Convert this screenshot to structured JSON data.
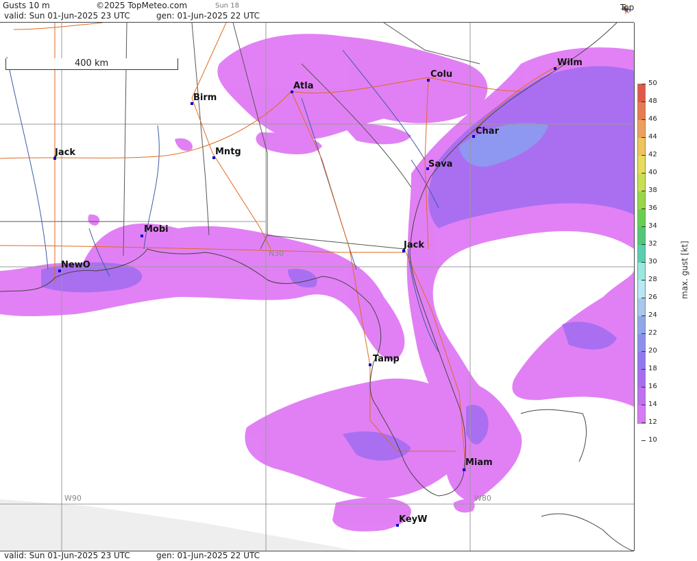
{
  "header": {
    "product": "Gusts 10 m",
    "copyright": "©2025 TopMeteo.com",
    "day_short": "Sun 18",
    "valid": "valid:  Sun  01-Jun-2025  23 UTC",
    "gen": "gen: 01-Jun-2025 22 UTC",
    "logo": "TopMeteo"
  },
  "footer": {
    "valid": "valid:  Sun  01-Jun-2025  23 UTC",
    "gen": "gen: 01-Jun-2025 22 UTC"
  },
  "scale_bar": {
    "label": "400 km"
  },
  "grid_labels": {
    "w90": "W90",
    "w80": "W80",
    "n30": "N30"
  },
  "cities": [
    {
      "name": "Birm"
    },
    {
      "name": "Atla"
    },
    {
      "name": "Colu"
    },
    {
      "name": "Wilm"
    },
    {
      "name": "Char"
    },
    {
      "name": "Sava"
    },
    {
      "name": "Jack"
    },
    {
      "name": "Mntg"
    },
    {
      "name": "Mobi"
    },
    {
      "name": "NewO"
    },
    {
      "name": "Jack"
    },
    {
      "name": "Tamp"
    },
    {
      "name": "Miam"
    },
    {
      "name": "KeyW"
    }
  ],
  "legend": {
    "title": "max. gust  [kt]",
    "ticks": [
      "50",
      "48",
      "46",
      "44",
      "42",
      "40",
      "38",
      "36",
      "34",
      "32",
      "30",
      "28",
      "26",
      "24",
      "22",
      "20",
      "18",
      "16",
      "14",
      "12",
      "10"
    ],
    "colors": [
      "#e0584a",
      "#e87a52",
      "#eea05a",
      "#f0c45c",
      "#e8dc58",
      "#c8e050",
      "#98d848",
      "#68d050",
      "#50c878",
      "#58d0b0",
      "#9ae8e0",
      "#b8e8f4",
      "#a8c8ec",
      "#90a8e8",
      "#8c90ec",
      "#9278f0",
      "#a86cf0",
      "#c070f0",
      "#d87af4"
    ]
  }
}
